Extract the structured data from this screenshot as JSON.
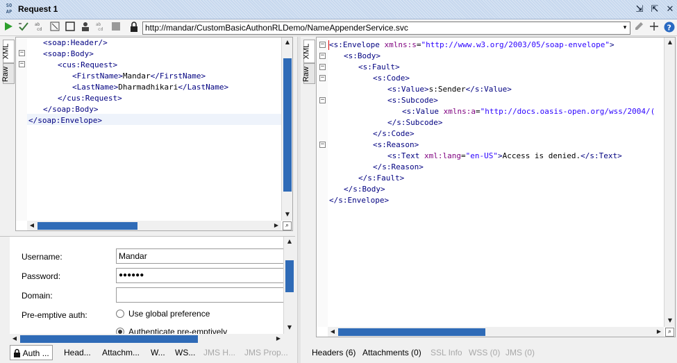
{
  "window": {
    "logo": "SO\nAP",
    "title": "Request 1",
    "controls": [
      "⇲",
      "⇱",
      "✕"
    ]
  },
  "toolbar": {
    "url": "http://mandar/CustomBasicAuthonRLDemo/NameAppenderService.svc",
    "url_drop": "▾"
  },
  "request_tabs": [
    "XML",
    "Raw"
  ],
  "response_tabs": [
    "XML",
    "Raw"
  ],
  "request_xml": [
    [
      {
        "c": "t",
        "s": "<soap:Header/>"
      }
    ],
    [
      {
        "c": "t",
        "s": "<soap:Body>"
      }
    ],
    [
      {
        "c": "t",
        "s": "<cus:Request>"
      }
    ],
    [
      {
        "c": "t",
        "s": "<FirstName>"
      },
      {
        "c": "x",
        "s": "Mandar"
      },
      {
        "c": "t",
        "s": "</FirstName>"
      }
    ],
    [
      {
        "c": "t",
        "s": "<LastName>"
      },
      {
        "c": "x",
        "s": "Dharmadhikari"
      },
      {
        "c": "t",
        "s": "</LastName>"
      }
    ],
    [
      {
        "c": "t",
        "s": "</cus:Request>"
      }
    ],
    [
      {
        "c": "t",
        "s": "</soap:Body>"
      }
    ],
    [
      {
        "c": "t",
        "s": "</soap:Envelope>"
      }
    ]
  ],
  "response_xml": [
    [
      {
        "c": "t",
        "s": "<s:Envelope "
      },
      {
        "c": "a",
        "s": "xmlns:s"
      },
      {
        "c": "x",
        "s": "="
      },
      {
        "c": "v",
        "s": "\"http://www.w3.org/2003/05/soap-envelope\""
      },
      {
        "c": "t",
        "s": ">"
      }
    ],
    [
      {
        "c": "t",
        "s": "<s:Body>"
      }
    ],
    [
      {
        "c": "t",
        "s": "<s:Fault>"
      }
    ],
    [
      {
        "c": "t",
        "s": "<s:Code>"
      }
    ],
    [
      {
        "c": "t",
        "s": "<s:Value>"
      },
      {
        "c": "x",
        "s": "s:Sender"
      },
      {
        "c": "t",
        "s": "</s:Value>"
      }
    ],
    [
      {
        "c": "t",
        "s": "<s:Subcode>"
      }
    ],
    [
      {
        "c": "t",
        "s": "<s:Value "
      },
      {
        "c": "a",
        "s": "xmlns:a"
      },
      {
        "c": "x",
        "s": "="
      },
      {
        "c": "v",
        "s": "\"http://docs.oasis-open.org/wss/2004/("
      }
    ],
    [
      {
        "c": "t",
        "s": "</s:Subcode>"
      }
    ],
    [
      {
        "c": "t",
        "s": "</s:Code>"
      }
    ],
    [
      {
        "c": "t",
        "s": "<s:Reason>"
      }
    ],
    [
      {
        "c": "t",
        "s": "<s:Text "
      },
      {
        "c": "a",
        "s": "xml:lang"
      },
      {
        "c": "x",
        "s": "="
      },
      {
        "c": "v",
        "s": "\"en-US\""
      },
      {
        "c": "t",
        "s": ">"
      },
      {
        "c": "x",
        "s": "Access is denied."
      },
      {
        "c": "t",
        "s": "</s:Text>"
      }
    ],
    [
      {
        "c": "t",
        "s": "</s:Reason>"
      }
    ],
    [
      {
        "c": "t",
        "s": "</s:Fault>"
      }
    ],
    [
      {
        "c": "t",
        "s": "</s:Body>"
      }
    ],
    [
      {
        "c": "t",
        "s": "</s:Envelope>"
      }
    ]
  ],
  "auth_form": {
    "username_label": "Username:",
    "username_value": "Mandar",
    "password_label": "Password:",
    "password_value": "●●●●●●",
    "domain_label": "Domain:",
    "domain_value": "",
    "preemptive_label": "Pre-emptive auth:",
    "option_global": "Use global preference",
    "option_preemptive": "Authenticate pre-emptively"
  },
  "request_bottom_tabs": [
    "Auth ...",
    "Head...",
    "Attachm...",
    "W...",
    "WS...",
    "JMS H...",
    "JMS Prop..."
  ],
  "response_bottom_tabs": [
    "Headers (6)",
    "Attachments (0)",
    "SSL Info",
    "WSS (0)",
    "JMS (0)"
  ],
  "colors": {
    "xml_tag": "#000080",
    "xml_attr": "#7f007f",
    "xml_value": "#2a00ff",
    "scroll_thumb": "#2f6bb7",
    "titlebar": "#c7d8ee"
  }
}
